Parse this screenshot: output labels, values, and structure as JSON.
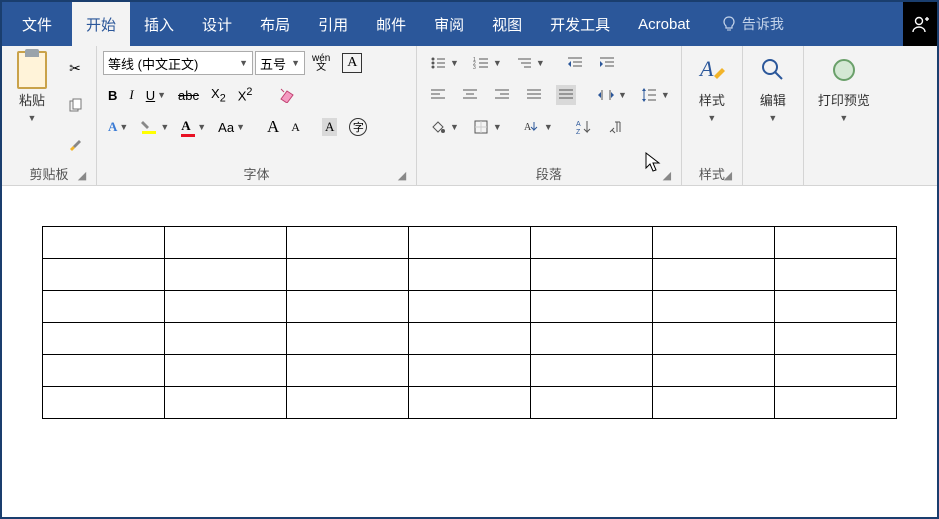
{
  "tabs": {
    "file": "文件",
    "home": "开始",
    "insert": "插入",
    "design": "设计",
    "layout": "布局",
    "references": "引用",
    "mailings": "邮件",
    "review": "审阅",
    "view": "视图",
    "developer": "开发工具",
    "acrobat": "Acrobat"
  },
  "tellme": "告诉我",
  "clipboard": {
    "paste": "粘贴",
    "label": "剪贴板"
  },
  "font": {
    "name": "等线 (中文正文)",
    "size": "五号",
    "phonetic": "wén",
    "label": "字体"
  },
  "paragraph": {
    "label": "段落"
  },
  "styles": {
    "button": "样式",
    "label": "样式"
  },
  "editing": {
    "button": "编辑"
  },
  "printpreview": {
    "button": "打印预览"
  },
  "table": {
    "rows": 6,
    "cols": 7
  }
}
